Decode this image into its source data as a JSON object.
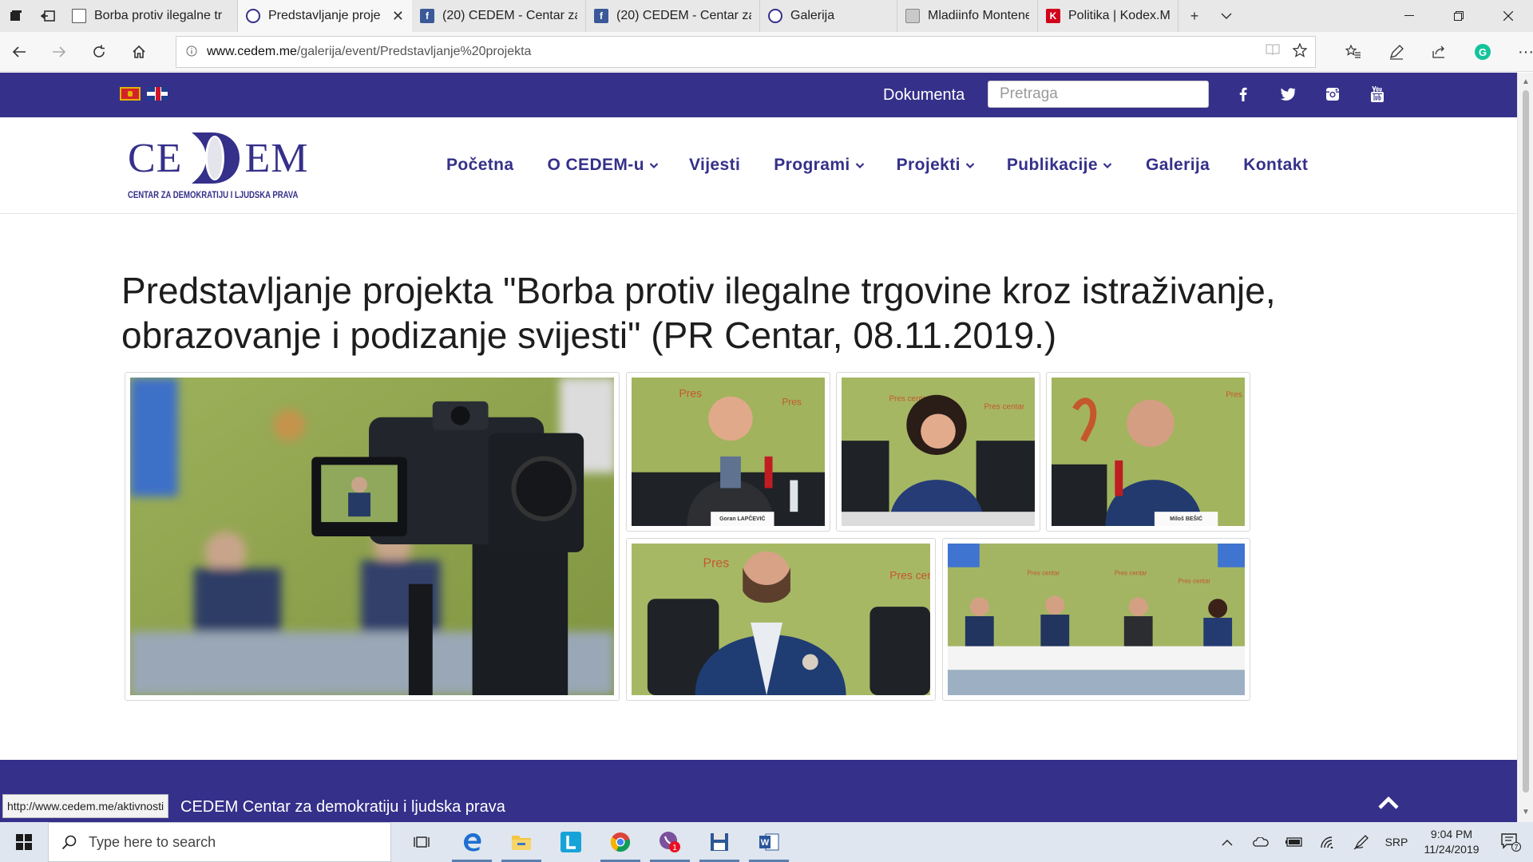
{
  "browser": {
    "tabs": [
      {
        "title": "Borba protiv ilegalne tr",
        "icon": "page-icon",
        "active": false
      },
      {
        "title": "Predstavljanje proje",
        "icon": "cedem-icon",
        "active": true
      },
      {
        "title": "(20) CEDEM - Centar za",
        "icon": "facebook-icon",
        "active": false
      },
      {
        "title": "(20) CEDEM - Centar za",
        "icon": "facebook-icon",
        "active": false
      },
      {
        "title": "Galerija",
        "icon": "cedem-icon",
        "active": false
      },
      {
        "title": "Mladiinfo Montenegro",
        "icon": "mladiinfo-icon",
        "active": false
      },
      {
        "title": "Politika | Kodex.ME",
        "icon": "kodex-icon",
        "active": false
      }
    ],
    "url_host": "www.cedem.me",
    "url_path": "/galerija/event/Predstavljanje%20projekta"
  },
  "site": {
    "topbar": {
      "documents_label": "Dokumenta",
      "search_placeholder": "Pretraga",
      "socials": [
        "facebook-icon",
        "twitter-icon",
        "instagram-icon",
        "youtube-icon"
      ]
    },
    "logo": {
      "left": "CE",
      "right": "EM",
      "subtitle": "CENTAR ZA DEMOKRATIJU I LJUDSKA PRAVA"
    },
    "nav": [
      {
        "label": "Početna",
        "dropdown": false
      },
      {
        "label": "O CEDEM-u",
        "dropdown": true
      },
      {
        "label": "Vijesti",
        "dropdown": false
      },
      {
        "label": "Programi",
        "dropdown": true
      },
      {
        "label": "Projekti",
        "dropdown": true
      },
      {
        "label": "Publikacije",
        "dropdown": true
      },
      {
        "label": "Galerija",
        "dropdown": false
      },
      {
        "label": "Kontakt",
        "dropdown": false
      }
    ],
    "page_title": "Predstavljanje projekta \"Borba protiv ilegalne trgovine kroz istraživanje, obrazovanje i podizanje svijesti\" (PR Centar, 08.11.2019.)",
    "gallery_captions": [
      "Goran LAPČEVIĆ",
      "Miloš BEŠIĆ"
    ],
    "footer_text": "CEDEM Centar za demokratiju i ljudska prava",
    "status_link": "http://www.cedem.me/aktivnosti"
  },
  "taskbar": {
    "search_placeholder": "Type here to search",
    "language": "SRP",
    "time": "9:04 PM",
    "date": "11/24/2019",
    "notification_count": "7",
    "viber_badge": "1"
  },
  "colors": {
    "brand": "#35308a",
    "footer": "#35308a",
    "photo_wall": "#8fa54a"
  }
}
